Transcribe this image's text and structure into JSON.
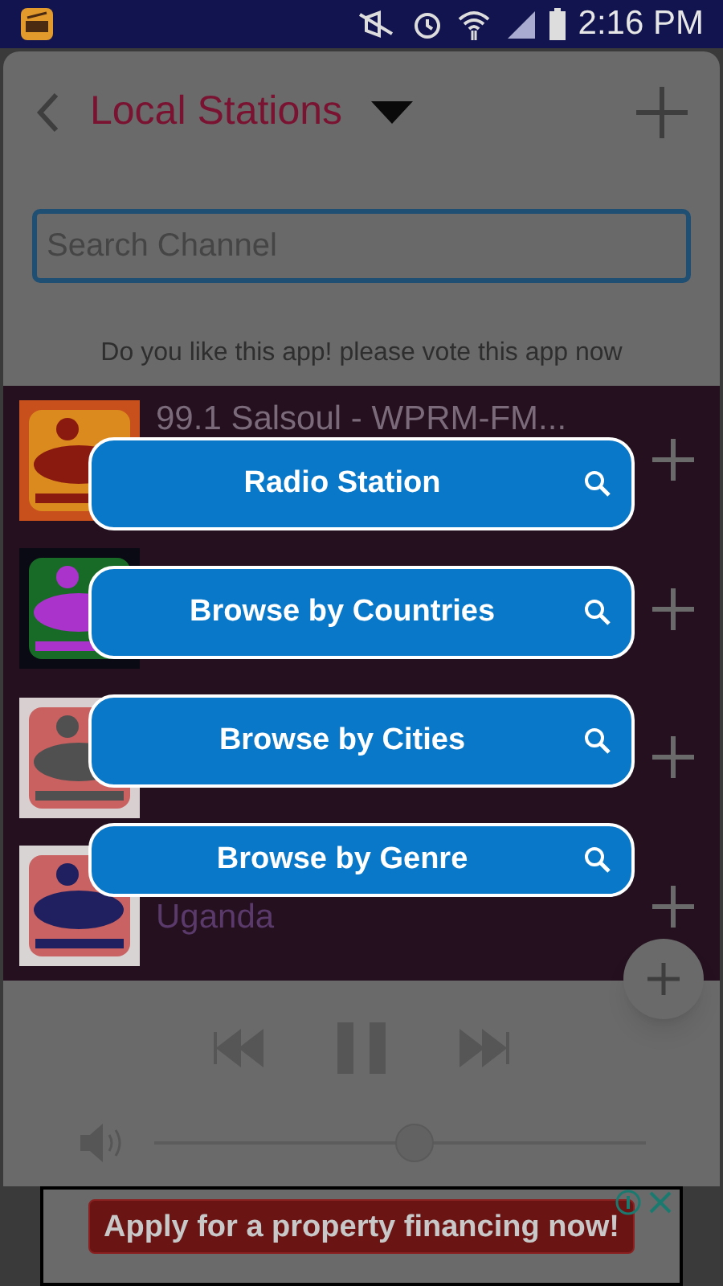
{
  "status_bar": {
    "time": "2:16 PM"
  },
  "header": {
    "title": "Local Stations"
  },
  "search": {
    "placeholder": "Search Channel"
  },
  "vote_prompt": "Do you like this app! please vote this app now",
  "stations": [
    {
      "kind": "picture",
      "name": "99.1 Salsoul - WPRM-FM..."
    },
    {
      "kind": "picture"
    },
    {
      "kind": "picture"
    },
    {
      "kind": "picture",
      "name": "Uganda"
    }
  ],
  "menu": [
    {
      "label": "Radio Station"
    },
    {
      "label": "Browse by Countries"
    },
    {
      "label": "Browse by Cities"
    },
    {
      "label": "Browse by Genre"
    }
  ],
  "player": {
    "volume": {
      "level": 0.53
    }
  },
  "ad": {
    "text": "Apply for a property financing now!"
  }
}
